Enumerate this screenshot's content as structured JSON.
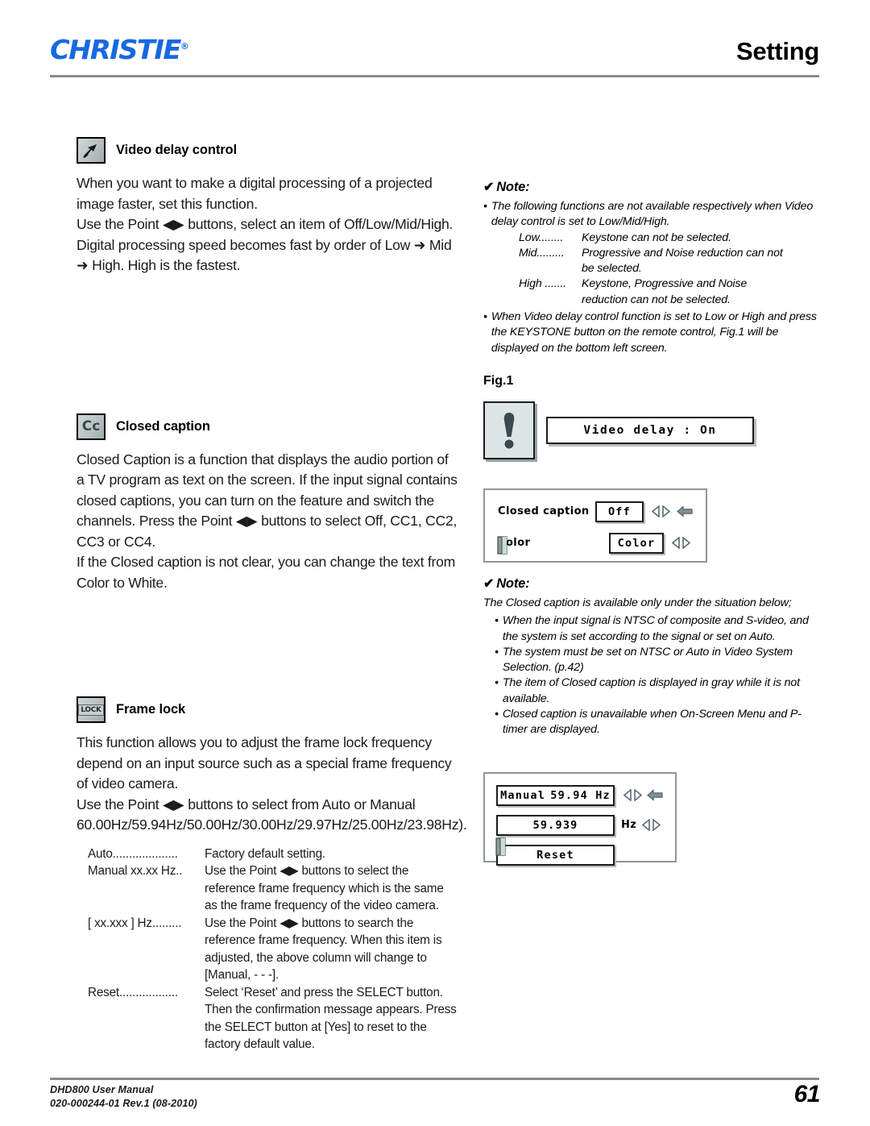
{
  "header": {
    "brand": "CHRISTIE",
    "brand_reg": "®",
    "title": "Setting"
  },
  "sections": {
    "video_delay": {
      "icon_name": "video-delay-icon",
      "title": "Video delay control",
      "paragraphs": [
        "When you want to make a digital processing of a projected image faster, set this function.",
        "Use the Point ◀▶ buttons, select an item of Off/Low/Mid/High.",
        "Digital processing speed becomes fast by order of Low ➜ Mid ➜ High. High is the fastest."
      ]
    },
    "closed_caption": {
      "icon_name": "closed-caption-icon",
      "icon_text": "Cc",
      "title": "Closed caption",
      "paragraphs": [
        "Closed Caption is a function that displays the audio portion of a TV program as text on the screen. If the input signal contains closed captions, you can turn on the feature and switch the channels. Press the Point ◀▶ buttons to select Off, CC1, CC2, CC3 or CC4.",
        "If the Closed caption is not clear, you can change the text from Color to White."
      ]
    },
    "frame_lock": {
      "icon_name": "frame-lock-icon",
      "icon_text": "LOCK",
      "title": "Frame lock",
      "paragraphs": [
        "This function allows you to adjust the frame lock frequency depend on an input source such as a special frame frequency of video camera.",
        "Use the Point ◀▶ buttons to select from Auto or Manual 60.00Hz/59.94Hz/50.00Hz/30.00Hz/29.97Hz/25.00Hz/23.98Hz)."
      ],
      "definitions": [
        {
          "term": "Auto",
          "leader": "....................",
          "desc": "Factory default setting."
        },
        {
          "term": "Manual xx.xx Hz",
          "leader": "..",
          "desc": "Use the Point ◀▶ buttons to select the reference frame frequency which is the same as the frame frequency of the video camera."
        },
        {
          "term": "[ xx.xxx ] Hz",
          "leader": ".........",
          "desc": "Use the Point ◀▶ buttons to search the reference frame frequency. When this item is adjusted, the above column will change to [Manual, - - -]."
        },
        {
          "term": "Reset",
          "leader": "..................",
          "desc": "Select ‘Reset’ and press the SELECT button. Then the confirmation message appears. Press the SELECT button at [Yes]  to reset to the factory default value."
        }
      ]
    }
  },
  "note1": {
    "title": "Note:",
    "check": "✔",
    "items": [
      "The following functions are not available respectively when Video delay control is set to Low/Mid/High."
    ],
    "sub_items": [
      {
        "key": "Low........",
        "value": "Keystone can not be selected."
      },
      {
        "key": "Mid.........",
        "value": "Progressive and Noise reduction can not",
        "cont": "be selected."
      },
      {
        "key": "High .......",
        "value": "Keystone, Progressive and Noise",
        "cont": "reduction can not be selected."
      }
    ],
    "items2": [
      "When Video delay control function is set to Low or High and press the KEYSTONE button on the remote control, Fig.1 will be displayed on the bottom left screen."
    ]
  },
  "fig1": {
    "label": "Fig.1",
    "icon_name": "exclamation-icon",
    "message": "Video delay : On"
  },
  "cc_dialog": {
    "rows": [
      {
        "label": "Closed caption",
        "value": "Off",
        "has_back_arrow": true
      },
      {
        "label": "Color",
        "value": "Color",
        "has_back_arrow": false
      }
    ],
    "book_icon": "book-icon"
  },
  "note2": {
    "title": "Note:",
    "check": "✔",
    "intro": "The Closed caption is available only under the situation below;",
    "items": [
      "When the input signal is NTSC of composite and S-video, and the system is set according to the signal or set on Auto.",
      "The system must be set on NTSC or Auto in Video System Selection. (p.42)",
      "The item of Closed caption is displayed in gray while it is not available.",
      "Closed caption is unavailable when On-Screen Menu and P-timer are displayed."
    ]
  },
  "fl_dialog": {
    "row1": {
      "mode": "Manual",
      "freq": "59.94 Hz",
      "has_back_arrow": true
    },
    "row2": {
      "value": "59.939",
      "unit": "Hz"
    },
    "row3": {
      "label": "Reset"
    },
    "book_icon": "book-icon"
  },
  "footer": {
    "line1": "DHD800 User Manual",
    "line2": "020-000244-01 Rev.1 (08-2010)",
    "page_number": "61"
  },
  "colors": {
    "brand_blue": "#1769e0",
    "rule_gray": "#8a8a8a",
    "osd_border": "#8e9696",
    "icon_gray": "#b9c2c2"
  }
}
